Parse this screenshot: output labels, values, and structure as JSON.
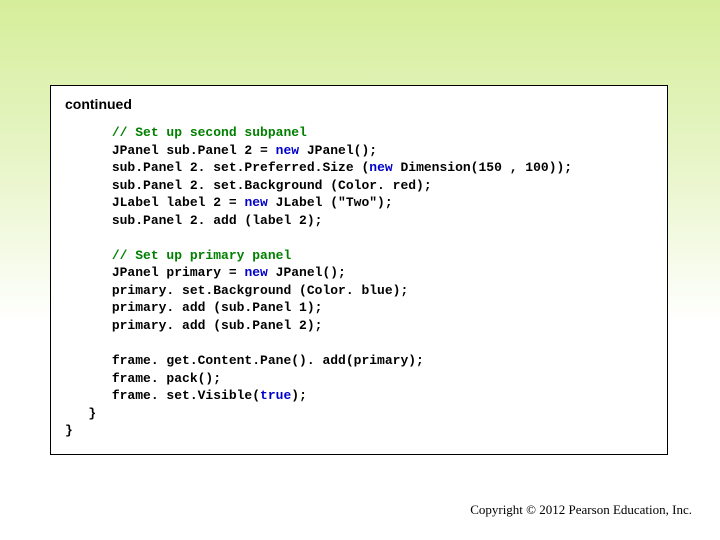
{
  "header": {
    "continued": "continued"
  },
  "code": {
    "c1": "// Set up second subpanel",
    "l1a": "JPanel sub.Panel 2 = ",
    "l1b": "new",
    "l1c": " JPanel();",
    "l2a": "sub.Panel 2. set.Preferred.Size (",
    "l2b": "new",
    "l2c": " Dimension(150 , 100));",
    "l3": "sub.Panel 2. set.Background (Color. red);",
    "l4a": "JLabel label 2 = ",
    "l4b": "new",
    "l4c": " JLabel (\"Two\");",
    "l5": "sub.Panel 2. add (label 2);",
    "c2": "// Set up primary panel",
    "l6a": "JPanel primary = ",
    "l6b": "new",
    "l6c": " JPanel();",
    "l7": "primary. set.Background (Color. blue);",
    "l8": "primary. add (sub.Panel 1);",
    "l9": "primary. add (sub.Panel 2);",
    "l10": "frame. get.Content.Pane(). add(primary);",
    "l11": "frame. pack();",
    "l12a": "frame. set.Visible(",
    "l12b": "true",
    "l12c": ");",
    "rb1": "}",
    "rb2": "}"
  },
  "footer": {
    "copyright": "Copyright © 2012 Pearson Education, Inc."
  }
}
